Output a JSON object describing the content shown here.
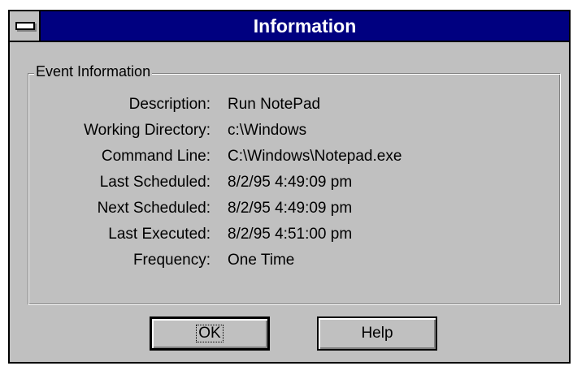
{
  "window": {
    "title": "Information"
  },
  "group": {
    "legend": "Event Information"
  },
  "fields": [
    {
      "label": "Description:",
      "value": "Run NotePad"
    },
    {
      "label": "Working Directory:",
      "value": "c:\\Windows"
    },
    {
      "label": "Command Line:",
      "value": "C:\\Windows\\Notepad.exe"
    },
    {
      "label": "Last Scheduled:",
      "value": "8/2/95 4:49:09 pm"
    },
    {
      "label": "Next Scheduled:",
      "value": "8/2/95 4:49:09 pm"
    },
    {
      "label": "Last Executed:",
      "value": "8/2/95 4:51:00 pm"
    },
    {
      "label": "Frequency:",
      "value": "One Time"
    }
  ],
  "buttons": {
    "ok_label": "OK",
    "help_label": "Help"
  },
  "colors": {
    "titlebar": "#000080",
    "face": "#c0c0c0",
    "title_text": "#ffffff"
  }
}
